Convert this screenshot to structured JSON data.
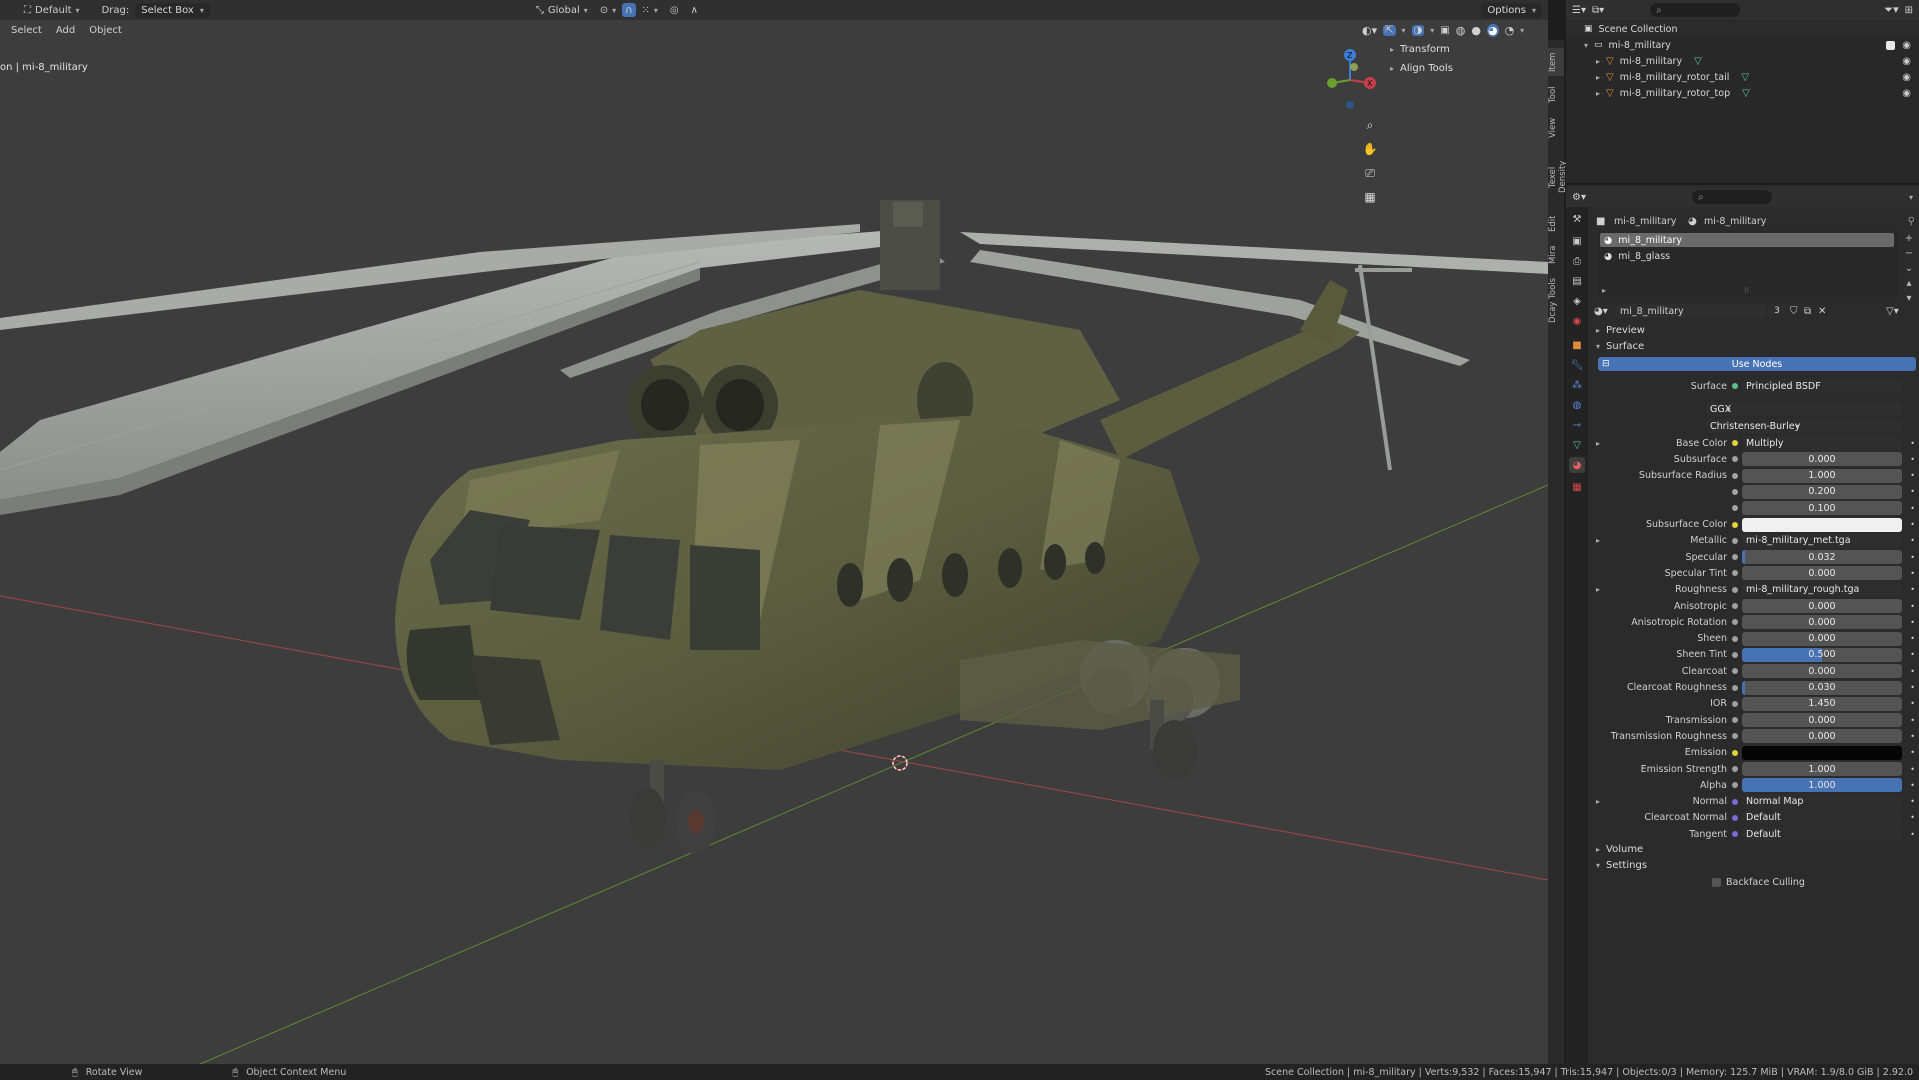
{
  "header": {
    "workspace": "Default",
    "drag_label": "Drag:",
    "drag_mode": "Select Box",
    "orientation": "Global",
    "options": "Options"
  },
  "menu": [
    "Select",
    "Add",
    "Object"
  ],
  "viewport": {
    "object_info": "on | mi-8_military"
  },
  "npanel": {
    "items": [
      "Transform",
      "Align Tools"
    ],
    "tabs": [
      "Item",
      "Tool",
      "View",
      "Texel Density",
      "Edit",
      "Mira",
      "Dcay Tools"
    ]
  },
  "outliner": {
    "root": "Scene Collection",
    "collection": "mi-8_military",
    "objects": [
      "mi-8_military",
      "mi-8_military_rotor_tail",
      "mi-8_military_rotor_top"
    ]
  },
  "properties": {
    "breadcrumb_object": "mi-8_military",
    "breadcrumb_material": "mi-8_military",
    "slots": [
      "mi_8_military",
      "mi_8_glass"
    ],
    "material_name": "mi_8_military",
    "users": "3",
    "sections": {
      "preview": "Preview",
      "surface": "Surface",
      "volume": "Volume",
      "settings": "Settings"
    },
    "use_nodes": "Use Nodes",
    "surface_label": "Surface",
    "surface_value": "Principled BSDF",
    "distribution": "GGX",
    "subsurface_method": "Christensen-Burley",
    "fields": [
      {
        "label": "Base Color",
        "value": "Multiply",
        "kind": "link",
        "dot": "#e3d33a"
      },
      {
        "label": "Subsurface",
        "value": "0.000",
        "kind": "num",
        "fill": 0
      },
      {
        "label": "Subsurface Radius",
        "value": "1.000",
        "kind": "num",
        "fill": 0
      },
      {
        "label": "",
        "value": "0.200",
        "kind": "num",
        "fill": 0
      },
      {
        "label": "",
        "value": "0.100",
        "kind": "num",
        "fill": 0
      },
      {
        "label": "Subsurface Color",
        "value": "",
        "kind": "color",
        "color": "#f0f0f0"
      },
      {
        "label": "Metallic",
        "value": "mi-8_military_met.tga",
        "kind": "link",
        "dot": "#a0a0a0"
      },
      {
        "label": "Specular",
        "value": "0.032",
        "kind": "num",
        "fill": 0.03
      },
      {
        "label": "Specular Tint",
        "value": "0.000",
        "kind": "num",
        "fill": 0
      },
      {
        "label": "Roughness",
        "value": "mi-8_military_rough.tga",
        "kind": "link",
        "dot": "#a0a0a0"
      },
      {
        "label": "Anisotropic",
        "value": "0.000",
        "kind": "num",
        "fill": 0
      },
      {
        "label": "Anisotropic Rotation",
        "value": "0.000",
        "kind": "num",
        "fill": 0
      },
      {
        "label": "Sheen",
        "value": "0.000",
        "kind": "num",
        "fill": 0
      },
      {
        "label": "Sheen Tint",
        "value": "0.500",
        "kind": "num",
        "fill": 0.5
      },
      {
        "label": "Clearcoat",
        "value": "0.000",
        "kind": "num",
        "fill": 0
      },
      {
        "label": "Clearcoat Roughness",
        "value": "0.030",
        "kind": "num",
        "fill": 0.03
      },
      {
        "label": "IOR",
        "value": "1.450",
        "kind": "num",
        "fill": 0
      },
      {
        "label": "Transmission",
        "value": "0.000",
        "kind": "num",
        "fill": 0
      },
      {
        "label": "Transmission Roughness",
        "value": "0.000",
        "kind": "num",
        "fill": 0
      },
      {
        "label": "Emission",
        "value": "",
        "kind": "color",
        "color": "#050505"
      },
      {
        "label": "Emission Strength",
        "value": "1.000",
        "kind": "num",
        "fill": 0
      },
      {
        "label": "Alpha",
        "value": "1.000",
        "kind": "num",
        "fill": 1
      },
      {
        "label": "Normal",
        "value": "Normal Map",
        "kind": "link",
        "dot": "#7b6ad8"
      },
      {
        "label": "Clearcoat Normal",
        "value": "Default",
        "kind": "link",
        "dot": "#7b6ad8"
      },
      {
        "label": "Tangent",
        "value": "Default",
        "kind": "link",
        "dot": "#7b6ad8"
      }
    ],
    "backface_culling": "Backface Culling"
  },
  "statusbar": {
    "left1": "Rotate View",
    "left2": "Object Context Menu",
    "right": "Scene Collection | mi-8_military | Verts:9,532 | Faces:15,947 | Tris:15,947 | Objects:0/3 | Memory: 125.7 MiB | VRAM: 1.9/8.0 GiB | 2.92.0"
  },
  "colors": {
    "accent": "#4772b3",
    "x_axis": "#c0404a",
    "y_axis": "#6aa030"
  }
}
